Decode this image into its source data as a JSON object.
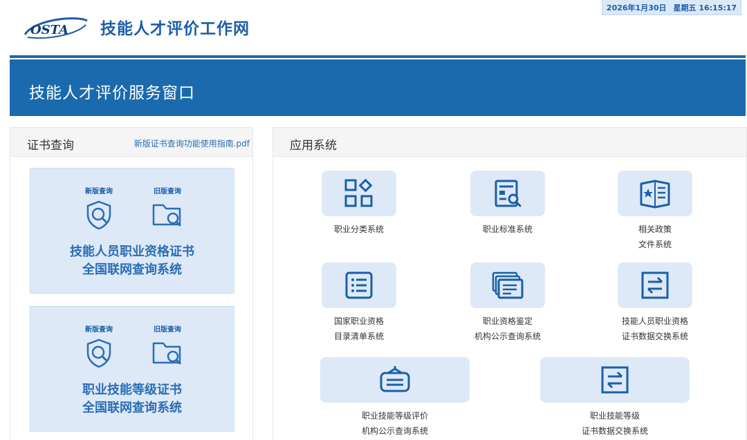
{
  "header": {
    "logo_text": "OSTA",
    "site_title": "技能人才评价工作网",
    "date": "2026年1月30日",
    "weekday_time": "星期五 16:15:17"
  },
  "banner": {
    "title": "技能人才评价服务窗口"
  },
  "cert_query": {
    "title": "证书查询",
    "guide_link": "新版证书查询功能使用指南.pdf",
    "cards": [
      {
        "new_label": "新版查询",
        "old_label": "旧版查询",
        "title_line1": "技能人员职业资格证书",
        "title_line2": "全国联网查询系统"
      },
      {
        "new_label": "新版查询",
        "old_label": "旧版查询",
        "title_line1": "职业技能等级证书",
        "title_line2": "全国联网查询系统"
      }
    ]
  },
  "apps": {
    "title": "应用系统",
    "items": [
      {
        "line1": "职业分类系统",
        "line2": "",
        "icon": "grid-icon"
      },
      {
        "line1": "职业标准系统",
        "line2": "",
        "icon": "document-search-icon"
      },
      {
        "line1": "相关政策",
        "line2": "文件系统",
        "icon": "policy-book-icon"
      },
      {
        "line1": "国家职业资格",
        "line2": "目录清单系统",
        "icon": "list-icon"
      },
      {
        "line1": "职业资格鉴定",
        "line2": "机构公示查询系统",
        "icon": "stacked-docs-icon"
      },
      {
        "line1": "技能人员职业资格",
        "line2": "证书数据交换系统",
        "icon": "exchange-icon"
      },
      {
        "line1": "职业技能等级评价",
        "line2": "机构公示查询系统",
        "icon": "signboard-icon"
      },
      {
        "line1": "职业技能等级",
        "line2": "证书数据交换系统",
        "icon": "exchange-icon"
      }
    ]
  },
  "colors": {
    "brand_blue": "#1a6aad",
    "card_bg": "#dde9f6",
    "icon_blue": "#1b5ea8"
  }
}
